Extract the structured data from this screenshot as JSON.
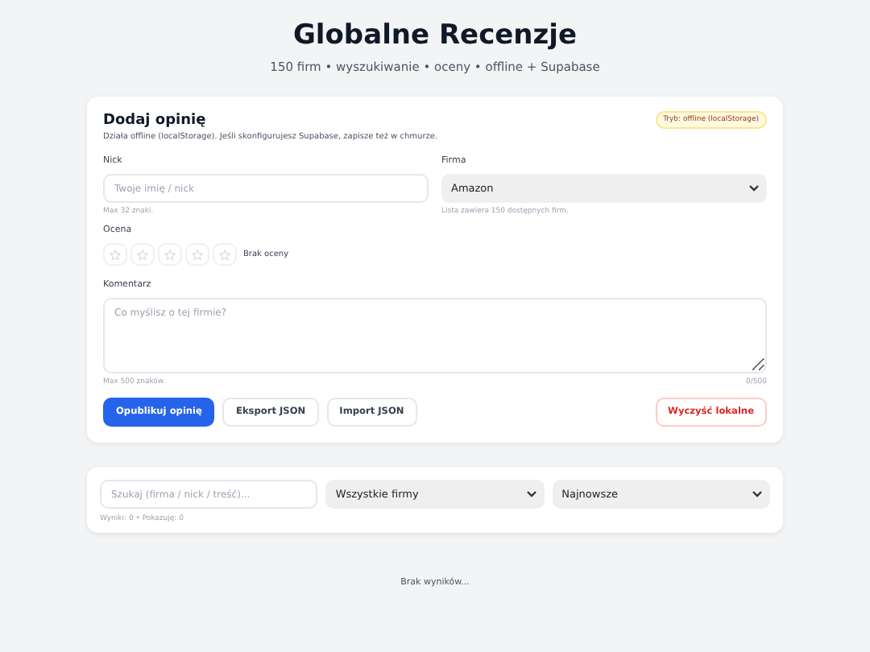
{
  "header": {
    "title": "Globalne Recenzje",
    "subtitle": "150 firm • wyszukiwanie • oceny • offline + Supabase"
  },
  "form": {
    "title": "Dodaj opinię",
    "mode_badge": "Tryb: offline (localStorage)",
    "description": "Działa offline (localStorage). Jeśli skonfigurujesz Supabase, zapisze też w chmurze.",
    "nick": {
      "label": "Nick",
      "placeholder": "Twoje imię / nick",
      "hint": "Max 32 znaki."
    },
    "company": {
      "label": "Firma",
      "value": "Amazon",
      "hint": "Lista zawiera 150 dostępnych firm."
    },
    "rating": {
      "label": "Ocena",
      "stars": 0,
      "status": "Brak oceny"
    },
    "comment": {
      "label": "Komentarz",
      "placeholder": "Co myślisz o tej firmie?",
      "hint": "Max 500 znaków.",
      "counter": "0/500"
    },
    "buttons": [
      {
        "label": "Opublikuj opinię",
        "kind": "primary"
      },
      {
        "label": "Eksport JSON",
        "kind": "secondary"
      },
      {
        "label": "Import JSON",
        "kind": "secondary"
      },
      {
        "label": "Wyczyść lokalne",
        "kind": "danger"
      }
    ]
  },
  "filters": {
    "search": {
      "placeholder": "Szukaj (firma / nick / treść)..."
    },
    "company_filter": {
      "value": "Wszystkie firmy"
    },
    "sort": {
      "value": "Najnowsze"
    },
    "results": "Wyniki: 0 • Pokazuję: 0"
  },
  "empty_message": "Brak wyników..."
}
